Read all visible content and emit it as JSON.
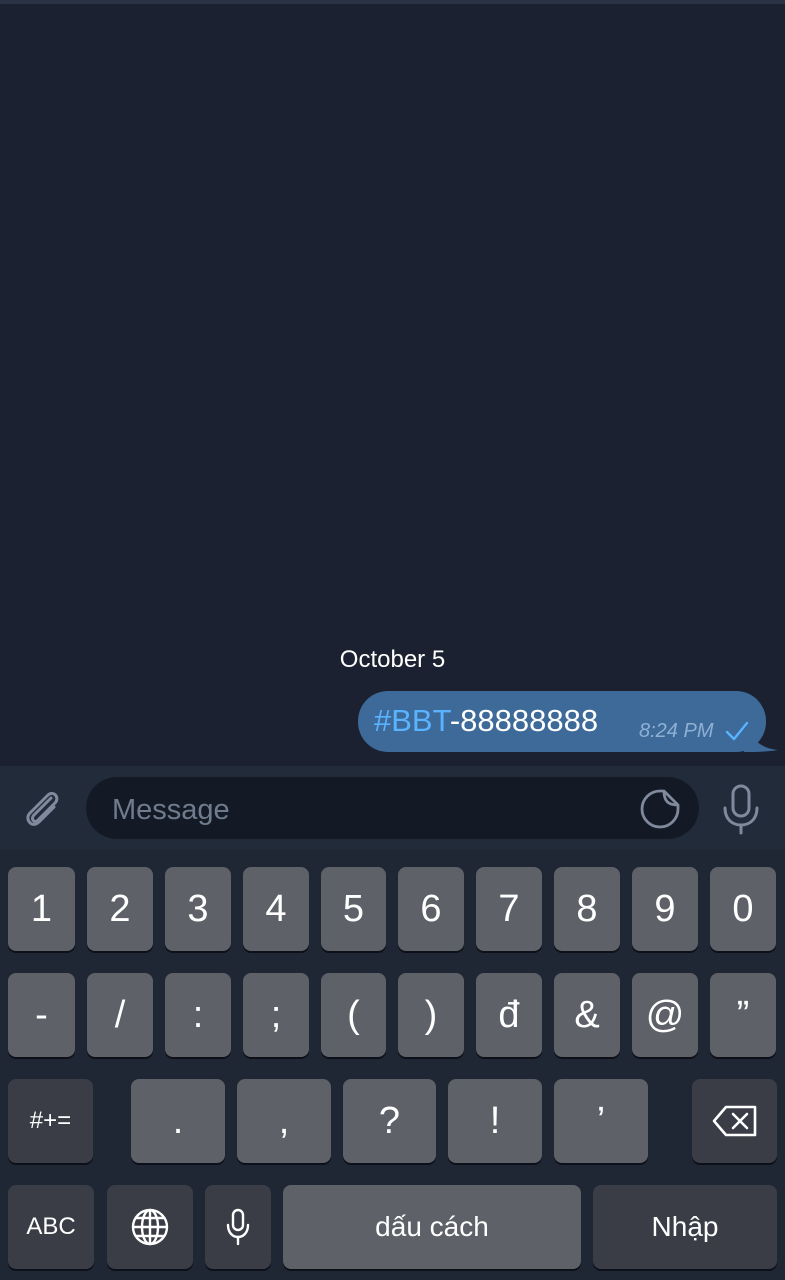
{
  "chat": {
    "date_label": "October 5",
    "message": {
      "hashtag": "#BBT",
      "text": "-88888888",
      "time": "8:24 PM",
      "status_icon": "check-icon"
    }
  },
  "composer": {
    "placeholder": "Message",
    "attach_icon": "paperclip-icon",
    "sticker_icon": "sticker-icon",
    "mic_icon": "microphone-icon"
  },
  "keyboard": {
    "row1": [
      "1",
      "2",
      "3",
      "4",
      "5",
      "6",
      "7",
      "8",
      "9",
      "0"
    ],
    "row2": [
      "-",
      "/",
      ":",
      ";",
      "(",
      ")",
      "đ",
      "&",
      "@",
      "”"
    ],
    "row3": [
      ".",
      ",",
      "?",
      "!",
      "’"
    ],
    "symbols_key": "#+=",
    "backspace_icon": "backspace-icon",
    "abc_key": "ABC",
    "globe_icon": "globe-icon",
    "dictation_icon": "microphone-icon",
    "space_key": "dấu cách",
    "return_key": "Nhập"
  },
  "colors": {
    "background": "#1b2130",
    "bubble": "#3d6a99",
    "hashtag": "#5ab3ff",
    "key": "#5e6168",
    "key_dark": "#3a3d45"
  }
}
